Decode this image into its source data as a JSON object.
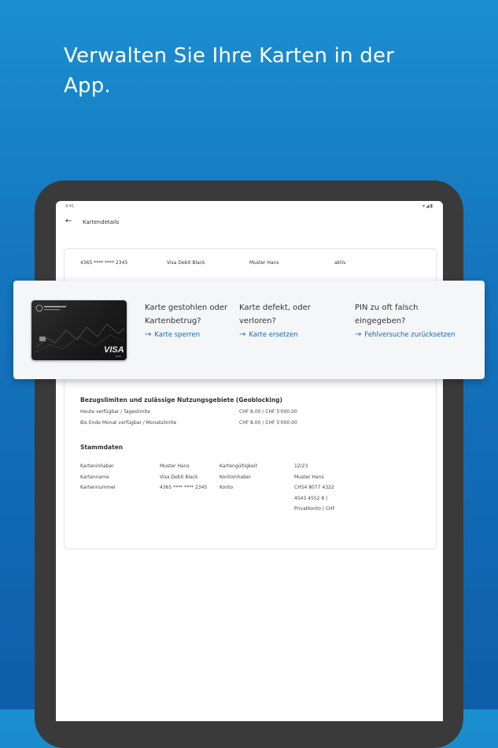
{
  "headline": "Verwalten Sie Ihre Karten in der App.",
  "status_bar": {
    "time": "9:41",
    "icons": "▾◢▮"
  },
  "app_bar": {
    "back_icon": "arrow-left",
    "title": "Kartendetails"
  },
  "card_summary": {
    "number": "4365 **** **** 2345",
    "product": "Visa Debit Black",
    "holder": "Muster Hans",
    "status": "aktiv"
  },
  "card_brand": "VISA",
  "card_sub": "Debit",
  "options": [
    {
      "question": "Karte gestohlen oder Kartenbetrug?",
      "link": "Karte sperren"
    },
    {
      "question": "Karte defekt, oder verloren?",
      "link": "Karte ersetzen"
    },
    {
      "question": "PIN zu oft falsch eingegeben?",
      "link": "Fehlversuche zurücksetzen"
    }
  ],
  "limits": {
    "title": "Bezugslimiten und zulässige Nutzungsgebiete (Geoblocking)",
    "rows": [
      {
        "label": "Heute verfügbar / Tageslimite",
        "value": "CHF 8.00 / CHF 5'000.00"
      },
      {
        "label": "Bis Ende Monat verfügbar / Monatslimite",
        "value": "CHF 8.00 / CHF 5'000.00"
      }
    ]
  },
  "master_data": {
    "title": "Stammdaten",
    "left_labels": [
      "Karteninhaber",
      "Kartenname",
      "Kartennummer"
    ],
    "left_values": [
      "Muster Hans",
      "Visa Debit Black",
      "4365 **** **** 2345"
    ],
    "right_labels": [
      "Kartengültigkeit",
      "Kontoinhaber",
      "Konto"
    ],
    "right_values": [
      "12/23",
      "Muster Hans",
      "CH54 8077 4322",
      "4543 4552 8 |",
      "Privatkonto | CHF"
    ]
  },
  "colors": {
    "accent": "#1769b5",
    "background_top": "#1b8fd0",
    "background_bottom": "#0e5ea9"
  }
}
